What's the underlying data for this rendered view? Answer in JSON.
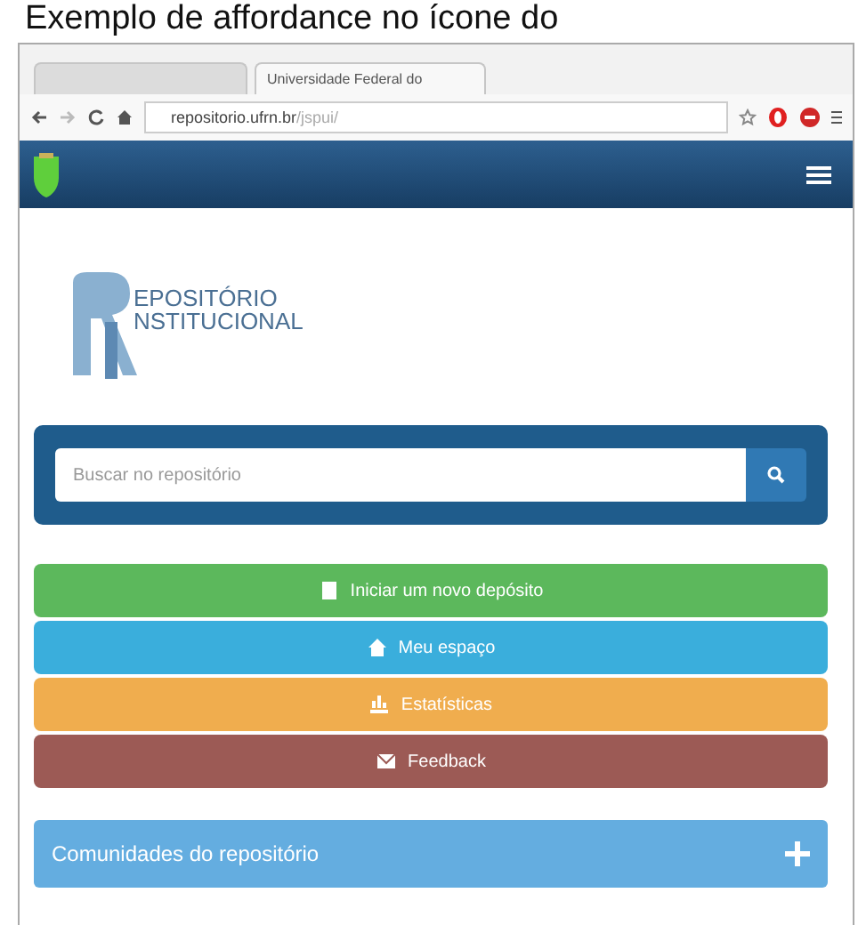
{
  "caption": "Exemplo de affordance no ícone do",
  "tabs": [
    {
      "selected": false
    },
    {
      "label": "Universidade Federal do",
      "selected": true
    }
  ],
  "address": {
    "host": "repositorio.ufrn.br",
    "path": "/jspui/"
  },
  "logo": {
    "line1": "EPOSITÓRIO",
    "line2": "NSTITUCIONAL"
  },
  "search": {
    "placeholder": "Buscar no repositório"
  },
  "actions": [
    {
      "label": "Iniciar um novo depósito",
      "color": "#5cb85c",
      "kind": "doc"
    },
    {
      "label": "Meu espaço",
      "color": "#3aaedc",
      "kind": "home"
    },
    {
      "label": "Estatísticas",
      "color": "#f0ad4e",
      "kind": "chart"
    },
    {
      "label": "Feedback",
      "color": "#9c5a55",
      "kind": "mail"
    }
  ],
  "panel": {
    "title": "Comunidades do repositório",
    "expanded": false
  }
}
